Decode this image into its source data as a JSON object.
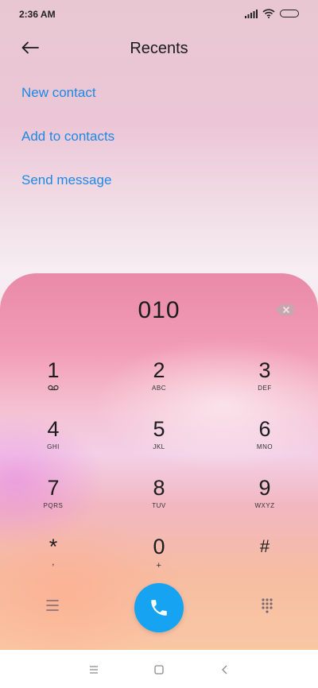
{
  "status_bar": {
    "time": "2:36 AM",
    "icons": [
      "signal-icon",
      "wifi-icon",
      "battery-icon"
    ]
  },
  "header": {
    "back_icon": "arrow-left-icon",
    "title": "Recents"
  },
  "actions": [
    {
      "label": "New contact"
    },
    {
      "label": "Add to contacts"
    },
    {
      "label": "Send message"
    }
  ],
  "dialer": {
    "number": "010",
    "backspace_icon": "backspace-icon",
    "keys": [
      {
        "digit": "1",
        "sub": "voicemail"
      },
      {
        "digit": "2",
        "sub": "ABC"
      },
      {
        "digit": "3",
        "sub": "DEF"
      },
      {
        "digit": "4",
        "sub": "GHI"
      },
      {
        "digit": "5",
        "sub": "JKL"
      },
      {
        "digit": "6",
        "sub": "MNO"
      },
      {
        "digit": "7",
        "sub": "PQRS"
      },
      {
        "digit": "8",
        "sub": "TUV"
      },
      {
        "digit": "9",
        "sub": "WXYZ"
      },
      {
        "digit": "*",
        "sub": ","
      },
      {
        "digit": "0",
        "sub": "+"
      },
      {
        "digit": "#",
        "sub": ""
      }
    ],
    "menu_icon": "hamburger-menu-icon",
    "call_icon": "phone-icon",
    "keypad_icon": "keypad-grid-icon",
    "call_color": "#16a3f2"
  },
  "navbar": {
    "icons": [
      "recents-menu-icon",
      "home-square-icon",
      "back-chevron-icon"
    ]
  }
}
